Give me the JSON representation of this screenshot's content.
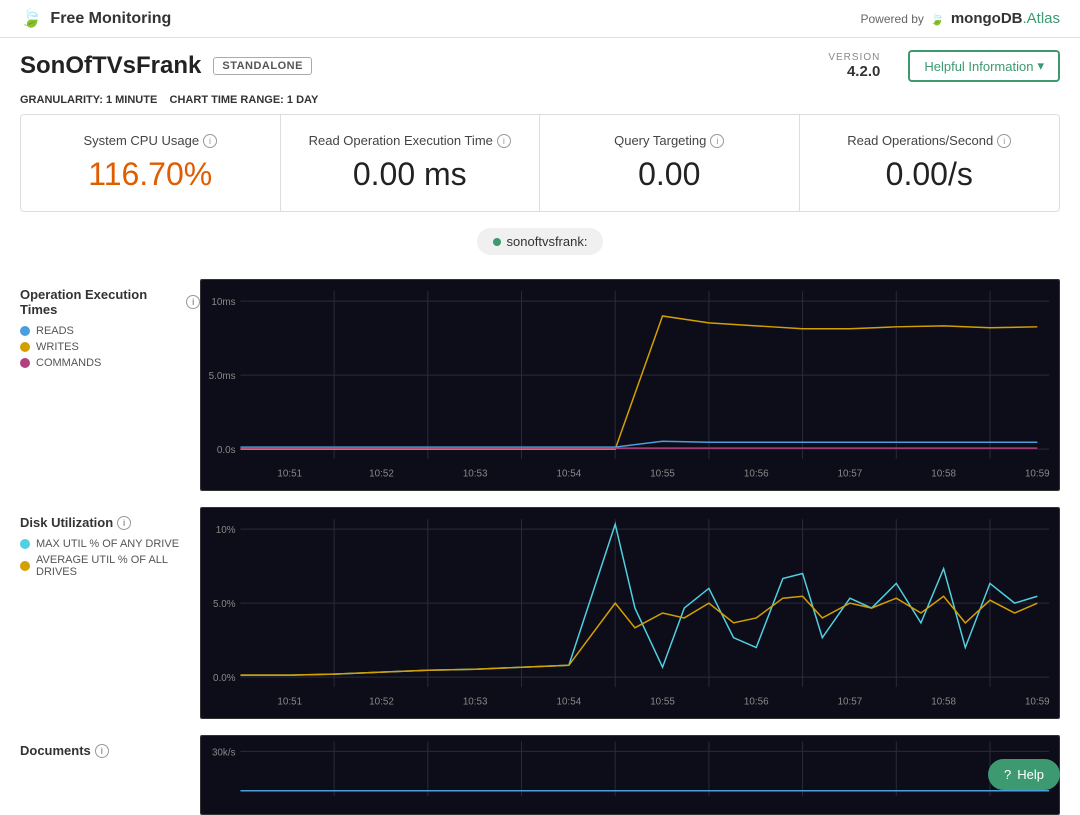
{
  "header": {
    "logo_text": "Free Monitoring",
    "powered_by": "Powered by",
    "mongo_logo": "mongoDB",
    "atlas_text": ".Atlas"
  },
  "subheader": {
    "title": "SonOfTVsFrank",
    "badge": "STANDALONE",
    "version_label": "VERSION",
    "version_num": "4.2.0",
    "helpful_btn": "Helpful Information"
  },
  "granularity": {
    "label": "GRANULARITY:",
    "granularity_val": "1 MINUTE",
    "range_label": "CHART TIME RANGE:",
    "range_val": "1 DAY"
  },
  "metrics": [
    {
      "label": "System CPU Usage",
      "value": "116.70%",
      "alert": true
    },
    {
      "label": "Read Operation Execution Time",
      "value": "0.00 ms",
      "alert": false
    },
    {
      "label": "Query Targeting",
      "value": "0.00",
      "alert": false
    },
    {
      "label": "Read Operations/Second",
      "value": "0.00/s",
      "alert": false
    }
  ],
  "host_bar": {
    "host": "sonoftvsfrank:"
  },
  "operation_chart": {
    "title": "Operation Execution Times",
    "legend": [
      {
        "label": "READS",
        "color": "#4a9ede"
      },
      {
        "label": "WRITES",
        "color": "#d4a000"
      },
      {
        "label": "COMMANDS",
        "color": "#b04080"
      }
    ],
    "y_labels": [
      "10ms",
      "5.0ms",
      "0.0s"
    ],
    "x_labels": [
      "10:51",
      "10:52",
      "10:53",
      "10:54",
      "10:55",
      "10:56",
      "10:57",
      "10:58",
      "10:59"
    ]
  },
  "disk_chart": {
    "title": "Disk Utilization",
    "legend": [
      {
        "label": "MAX UTIL % OF ANY DRIVE",
        "color": "#50d0e0"
      },
      {
        "label": "AVERAGE UTIL % OF ALL DRIVES",
        "color": "#d4a000"
      }
    ],
    "y_labels": [
      "10%",
      "5.0%",
      "0.0%"
    ],
    "x_labels": [
      "10:51",
      "10:52",
      "10:53",
      "10:54",
      "10:55",
      "10:56",
      "10:57",
      "10:58",
      "10:59"
    ]
  },
  "documents_chart": {
    "title": "Documents",
    "y_labels": [
      "30k/s"
    ],
    "x_labels": []
  },
  "help_btn": "Help"
}
